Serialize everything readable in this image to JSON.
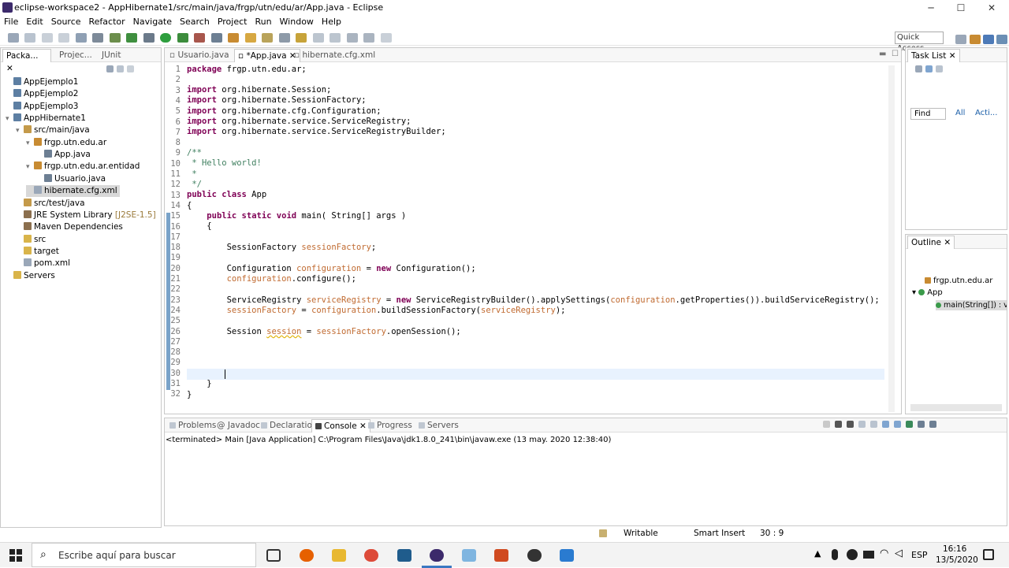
{
  "window": {
    "title": "eclipse-workspace2 - AppHibernate1/src/main/java/frgp/utn/edu/ar/App.java - Eclipse",
    "minimize": "─",
    "maximize": "☐",
    "close": "✕"
  },
  "menu": [
    "File",
    "Edit",
    "Source",
    "Refactor",
    "Navigate",
    "Search",
    "Project",
    "Run",
    "Window",
    "Help"
  ],
  "quick_access": "Quick Access",
  "explorer": {
    "tabs": [
      "Packa...",
      "Projec...",
      "JUnit"
    ],
    "items": [
      {
        "label": "AppEjemplo1",
        "indent": 0,
        "icon": "project-icon"
      },
      {
        "label": "AppEjemplo2",
        "indent": 0,
        "icon": "project-icon"
      },
      {
        "label": "AppEjemplo3",
        "indent": 0,
        "icon": "project-icon"
      },
      {
        "label": "AppHibernate1",
        "indent": 0,
        "icon": "project-icon",
        "expanded": true
      },
      {
        "label": "src/main/java",
        "indent": 1,
        "icon": "source-folder-icon",
        "expanded": true
      },
      {
        "label": "frgp.utn.edu.ar",
        "indent": 2,
        "icon": "package-icon",
        "expanded": true
      },
      {
        "label": "App.java",
        "indent": 3,
        "icon": "java-file-icon"
      },
      {
        "label": "frgp.utn.edu.ar.entidad",
        "indent": 2,
        "icon": "package-icon",
        "expanded": true
      },
      {
        "label": "Usuario.java",
        "indent": 3,
        "icon": "java-file-icon"
      },
      {
        "label": "hibernate.cfg.xml",
        "indent": 2,
        "icon": "xml-file-icon",
        "selected": true
      },
      {
        "label": "src/test/java",
        "indent": 1,
        "icon": "source-folder-icon"
      },
      {
        "label": "JRE System Library",
        "suffix": "[J2SE-1.5]",
        "indent": 1,
        "icon": "library-icon"
      },
      {
        "label": "Maven Dependencies",
        "indent": 1,
        "icon": "library-icon"
      },
      {
        "label": "src",
        "indent": 1,
        "icon": "folder-icon"
      },
      {
        "label": "target",
        "indent": 1,
        "icon": "folder-icon"
      },
      {
        "label": "pom.xml",
        "indent": 1,
        "icon": "xml-file-icon"
      },
      {
        "label": "Servers",
        "indent": 0,
        "icon": "folder-icon"
      }
    ]
  },
  "editor": {
    "tabs": [
      "Usuario.java",
      "*App.java",
      "hibernate.cfg.xml"
    ],
    "line_numbers": [
      "1",
      "2",
      "3",
      "4",
      "5",
      "6",
      "7",
      "8",
      "9",
      "10",
      "11",
      "12",
      "13",
      "14",
      "15",
      "16",
      "17",
      "18",
      "19",
      "20",
      "21",
      "22",
      "23",
      "24",
      "25",
      "26",
      "27",
      "28",
      "29",
      "30",
      "31",
      "32"
    ]
  },
  "tasklist": {
    "title": "Task List",
    "find": "Find",
    "all": "All",
    "activate": "Acti..."
  },
  "outline": {
    "title": "Outline",
    "package": "frgp.utn.edu.ar",
    "class": "App",
    "method": "main(String[]) : v"
  },
  "bottom": {
    "tabs": [
      "Problems",
      "Javadoc",
      "Declaration",
      "Console",
      "Progress",
      "Servers"
    ],
    "console_text": "<terminated> Main [Java Application] C:\\Program Files\\Java\\jdk1.8.0_241\\bin\\javaw.exe (13 may. 2020 12:38:40)"
  },
  "status": {
    "writable": "Writable",
    "insert": "Smart Insert",
    "position": "30 : 9"
  },
  "taskbar": {
    "search": "Escribe aquí para buscar",
    "lang": "ESP",
    "time": "16:16",
    "date": "13/5/2020"
  }
}
